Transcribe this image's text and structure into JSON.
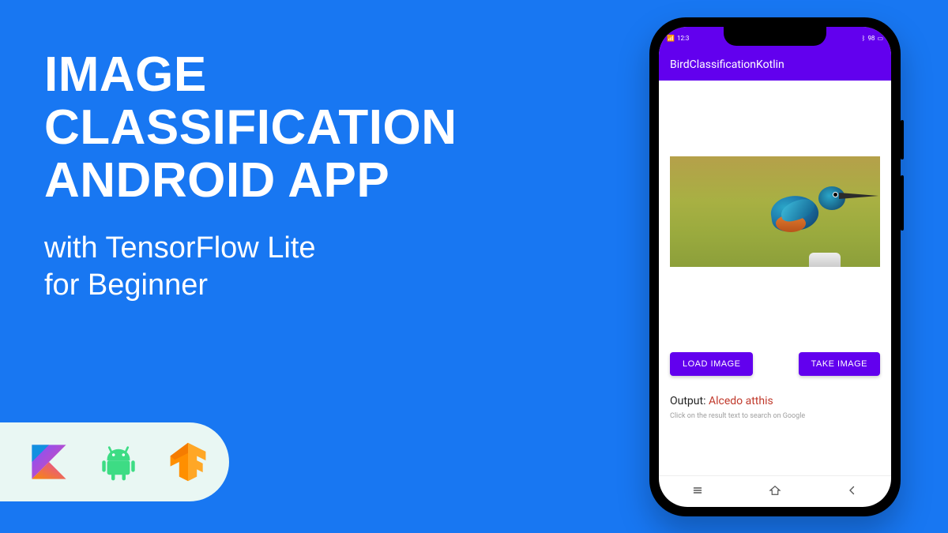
{
  "hero": {
    "title_line1": "IMAGE",
    "title_line2": "CLASSIFICATION",
    "title_line3": "ANDROID APP",
    "subtitle_line1": "with TensorFlow Lite",
    "subtitle_line2": "for Beginner"
  },
  "logos": {
    "kotlin": "kotlin-logo",
    "android": "android-logo",
    "tensorflow": "tensorflow-logo"
  },
  "phone": {
    "status": {
      "time": "12:3",
      "battery": "98"
    },
    "app_title": "BirdClassificationKotlin",
    "buttons": {
      "load": "LOAD IMAGE",
      "take": "TAKE IMAGE"
    },
    "output": {
      "label": "Output: ",
      "value": "Alcedo atthis"
    },
    "hint": "Click on the result text to search on Google"
  },
  "colors": {
    "bg": "#1877F2",
    "accent": "#6200EE",
    "output_value": "#C0392B"
  }
}
